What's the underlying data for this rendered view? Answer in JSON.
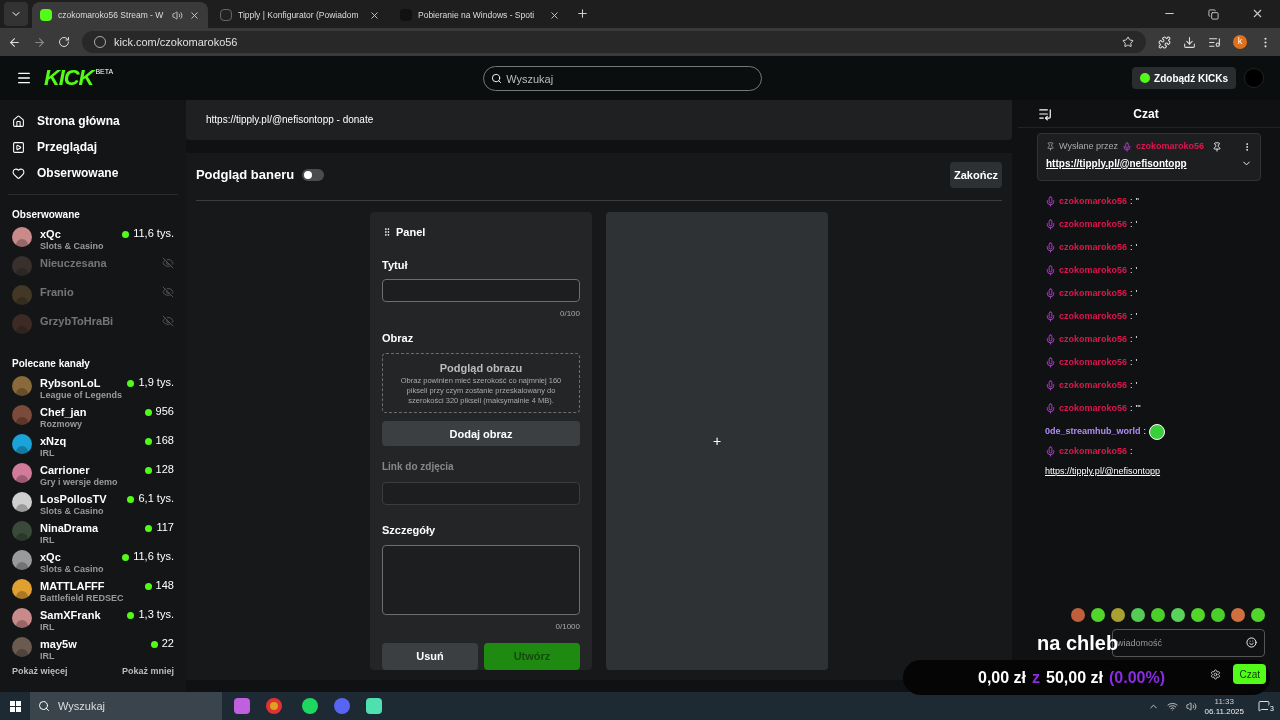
{
  "browser": {
    "tabs": [
      {
        "title": "czokomaroko56 Stream - W",
        "selected": true,
        "audio": true
      },
      {
        "title": "Tipply | Konfigurator (Powiadom",
        "selected": false,
        "audio": false
      },
      {
        "title": "Pobieranie na Windows - Spoti",
        "selected": false,
        "audio": false
      }
    ],
    "url": "kick.com/czokomaroko56",
    "profile": "k"
  },
  "header": {
    "logo": "KICK",
    "logo_tag": "BETA",
    "search": {
      "placeholder": "Wyszukaj"
    },
    "kicks_button": "Zdobądź KICKs"
  },
  "sidebar": {
    "nav": [
      "Strona główna",
      "Przeglądaj",
      "Obserwowane"
    ],
    "followed_title": "Obserwowane",
    "followed": [
      {
        "name": "xQc",
        "category": "Slots & Casino",
        "viewers": "11,6 tys.",
        "live": true
      },
      {
        "name": "Nieuczesana",
        "live": false
      },
      {
        "name": "Franio",
        "live": false
      },
      {
        "name": "GrzybToHraBi",
        "live": false
      }
    ],
    "recommended_title": "Polecane kanały",
    "recommended": [
      {
        "name": "RybsonLoL",
        "category": "League of Legends",
        "viewers": "1,9 tys.",
        "live": true
      },
      {
        "name": "Chef_jan",
        "category": "Rozmowy",
        "viewers": "956",
        "live": true
      },
      {
        "name": "xNzq",
        "category": "IRL",
        "viewers": "168",
        "live": true
      },
      {
        "name": "Carrioner",
        "category": "Gry i wersje demo",
        "viewers": "128",
        "live": true
      },
      {
        "name": "LosPollosTV",
        "category": "Slots & Casino",
        "viewers": "6,1 tys.",
        "live": true
      },
      {
        "name": "NinaDrama",
        "category": "IRL",
        "viewers": "117",
        "live": true
      },
      {
        "name": "xQc",
        "category": "Slots & Casino",
        "viewers": "11,6 tys.",
        "live": true
      },
      {
        "name": "MATTLAFFF",
        "category": "Battlefield REDSEC",
        "viewers": "148",
        "live": true
      },
      {
        "name": "SamXFrank",
        "category": "IRL",
        "viewers": "1,3 tys.",
        "live": true
      },
      {
        "name": "may5w",
        "category": "IRL",
        "viewers": "22",
        "live": true
      }
    ],
    "show_more": "Pokaż więcej",
    "show_less": "Pokaż mniej"
  },
  "about": {
    "text": "https://tipply.pl/@nefisontopp - donate"
  },
  "banner": {
    "title": "Podgląd baneru",
    "preview_on": false,
    "finish_button": "Zakończ",
    "panel": {
      "title": "Panel",
      "title_label": "Tytuł",
      "title_counter": "0/100",
      "image_label": "Obraz",
      "image_preview_title": "Podgląd obrazu",
      "image_preview_text": "Obraz powinien mieć szerokość co najmniej 160 pikseli przy czym zostanie przeskalowany do szerokości 320 pikseli (maksymalnie 4 MB).",
      "add_image_button": "Dodaj obraz",
      "link_label": "Link do zdjęcia",
      "details_label": "Szczegóły",
      "details_counter": "0/1000",
      "delete_button": "Usuń",
      "create_button": "Utwórz"
    },
    "add_symbol": "+"
  },
  "chat": {
    "title": "Czat",
    "pinned": {
      "label": "Wysłane przez",
      "user": "czokomaroko56",
      "text": "https://tipply.pl/@nefisontopp"
    },
    "messages": [
      {
        "user": "czokomaroko56",
        "colon": ":",
        "text": "''",
        "badge": true,
        "color": "#e0154f"
      },
      {
        "user": "czokomaroko56",
        "colon": ":",
        "text": "'",
        "badge": true,
        "color": "#e0154f"
      },
      {
        "user": "czokomaroko56",
        "colon": ":",
        "text": "'",
        "badge": true,
        "color": "#e0154f"
      },
      {
        "user": "czokomaroko56",
        "colon": ":",
        "text": "'",
        "badge": true,
        "color": "#e0154f"
      },
      {
        "user": "czokomaroko56",
        "colon": ":",
        "text": "'",
        "badge": true,
        "color": "#e0154f"
      },
      {
        "user": "czokomaroko56",
        "colon": ":",
        "text": "'",
        "badge": true,
        "color": "#e0154f"
      },
      {
        "user": "czokomaroko56",
        "colon": ":",
        "text": "'",
        "badge": true,
        "color": "#e0154f"
      },
      {
        "user": "czokomaroko56",
        "colon": ":",
        "text": "'",
        "badge": true,
        "color": "#e0154f"
      },
      {
        "user": "czokomaroko56",
        "colon": ":",
        "text": "'",
        "badge": true,
        "color": "#e0154f"
      },
      {
        "user": "czokomaroko56",
        "colon": ":",
        "text": "'''",
        "badge": true,
        "color": "#e0154f"
      },
      {
        "user": "0de_streamhub_world",
        "colon": ":",
        "kind": "emote",
        "badge": false,
        "color": "#b18cf5"
      },
      {
        "user": "czokomaroko56",
        "colon": ":",
        "text": "https://tipply.pl/@nefisontopp",
        "kind": "link",
        "badge": true,
        "color": "#e0154f"
      }
    ],
    "input": {
      "placeholder": "wiadomość"
    },
    "send_button": "Czat"
  },
  "goal": {
    "title": "na chleb",
    "current": "0,00 zł",
    "separator": "z",
    "target": "50,00 zł",
    "percent": "(0.00%)"
  },
  "taskbar": {
    "search": "Wyszukaj",
    "time": "11:33",
    "date": "06.11.2025",
    "notifications": "3"
  }
}
